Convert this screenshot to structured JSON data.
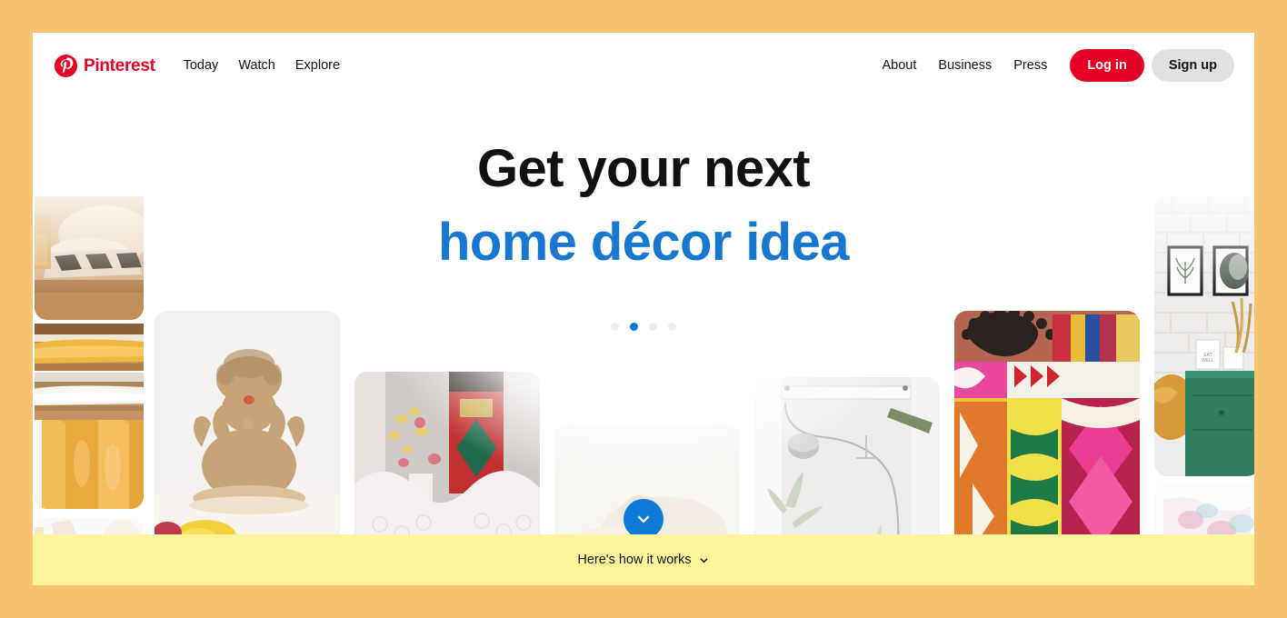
{
  "theme": {
    "page_background": "#F6C371",
    "panel_background": "#FFFFFF",
    "brand_red": "#E60023",
    "accent_blue": "#1878CF",
    "dot_active_blue": "#0C7AD9",
    "banner_yellow": "#FCF59B",
    "signup_grey": "#E1E1E1"
  },
  "header": {
    "logo_mark": "pinterest-p-icon",
    "logo_text": "Pinterest",
    "nav": [
      {
        "label": "Today",
        "name": "nav-link-today"
      },
      {
        "label": "Watch",
        "name": "nav-link-watch"
      },
      {
        "label": "Explore",
        "name": "nav-link-explore"
      }
    ],
    "secondary_nav": [
      {
        "label": "About",
        "name": "nav-link-about"
      },
      {
        "label": "Business",
        "name": "nav-link-business"
      },
      {
        "label": "Press",
        "name": "nav-link-press"
      }
    ],
    "login_label": "Log in",
    "signup_label": "Sign up"
  },
  "hero": {
    "line1": "Get your next",
    "line2": "home décor idea",
    "carousel": {
      "total_dots": 4,
      "active_index": 1
    }
  },
  "scroll_button": {
    "icon": "chevron-down-icon"
  },
  "banner": {
    "label": "Here's how it works",
    "chevron_icon": "chevron-down-icon"
  },
  "mosaic": {
    "tiles": [
      {
        "name": "tile-linen-pillows",
        "alt": "Beige pillow with patterned trim on wooden shelf"
      },
      {
        "name": "tile-folded-yellow-linens",
        "alt": "Folded yellow blanket on shelf"
      },
      {
        "name": "tile-white-towels",
        "alt": "Stack of white folded linens"
      },
      {
        "name": "tile-gold-cushions",
        "alt": "Row of gold embroidered cushions"
      },
      {
        "name": "tile-bottom-left-faded",
        "alt": "Faded white textile detail"
      },
      {
        "name": "tile-ganesha-statue",
        "alt": "Carved Ganesha statue with yellow flowers"
      },
      {
        "name": "tile-lace-window",
        "alt": "Lace curtains by a window with red and green panel"
      },
      {
        "name": "tile-white-bathroom",
        "alt": "White shower curtain with hanging lamp and plants"
      },
      {
        "name": "tile-ikat-cushions",
        "alt": "Brightly coloured ikat and kilim cushions"
      },
      {
        "name": "tile-brick-wall-frames",
        "alt": "White brick wall with framed prints above green dresser"
      },
      {
        "name": "tile-bottom-right-faded",
        "alt": "Faded pastel pattern detail"
      }
    ]
  }
}
